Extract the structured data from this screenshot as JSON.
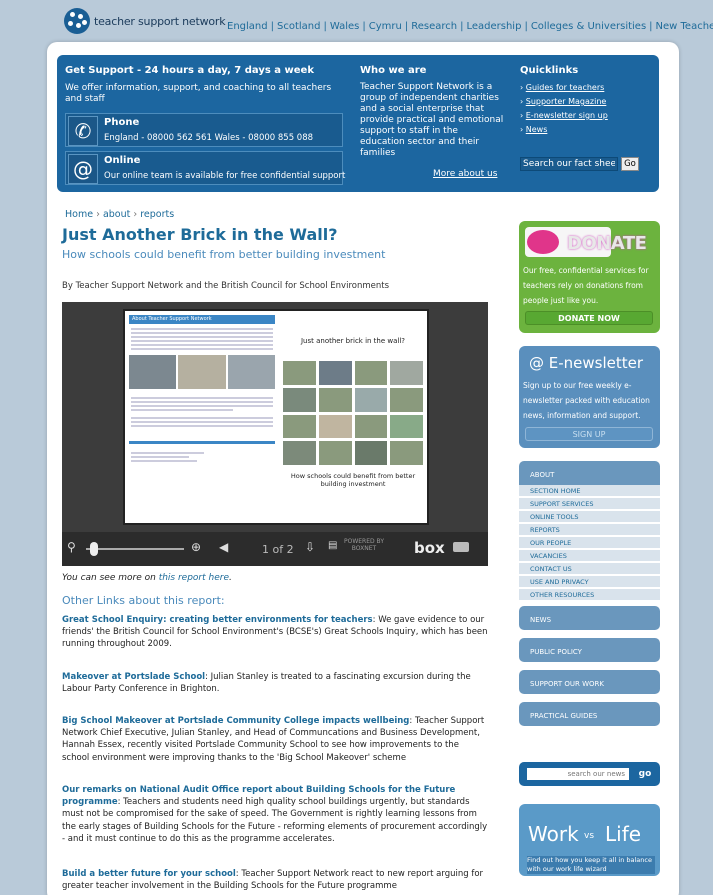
{
  "header": {
    "logo_text": "teacher support network",
    "nav": [
      "England",
      "Scotland",
      "Wales",
      "Cymru",
      "Research",
      "Leadership",
      "Colleges & Universities",
      "New Teachers"
    ]
  },
  "banner": {
    "get_support_title": "Get Support - 24 hours a day, 7 days a week",
    "get_support_text": "We offer information, support, and coaching to all teachers and staff",
    "phone_title": "Phone",
    "phone_text": "England - 08000 562 561 Wales - 08000 855 088",
    "online_title": "Online",
    "online_pre": "Our ",
    "online_link": "online team",
    "online_post": " is available for free confidential support",
    "who_title": "Who we are",
    "who_text": "Teacher Support Network is a group of independent charities and a social enterprise that provide practical and emotional support to staff in the education sector and their families",
    "who_more": "More about us",
    "quick_title": "Quicklinks",
    "quick_links": [
      "Guides for teachers",
      "Supporter Magazine",
      "E-newsletter sign up",
      "News"
    ],
    "search_placeholder": "Search our fact sheets",
    "search_go": "Go"
  },
  "breadcrumb": {
    "home": "Home",
    "about": "about",
    "current": "reports"
  },
  "article": {
    "title": "Just Another Brick in the Wall?",
    "subtitle": "How schools could benefit from better building investment",
    "byline": "By Teacher Support Network and the British Council for School Environments",
    "doc_header": "About Teacher Support Network",
    "doc_right_title": "Just another brick in the wall?",
    "doc_right_sub": "How schools could benefit from better building investment",
    "viewer_page": "1 of 2",
    "viewer_powered": "POWERED BY BOXNET",
    "viewer_brand": "box",
    "note_pre": "You can see more on ",
    "note_link": "this report here",
    "note_post": ".",
    "other_title": "Other Links about this report:",
    "links": [
      {
        "title": "Great School Enquiry: creating better environments for teachers",
        "text": ": We gave evidence to our friends' the British Council for School Environment's (BCSE's) Great Schools Inquiry, which has been running throughout 2009."
      },
      {
        "title": "Makeover at Portslade School",
        "text": ": Julian Stanley is treated to a fascinating excursion during the Labour Party Conference in Brighton."
      },
      {
        "title": "Big School Makeover at Portslade Community College impacts wellbeing",
        "text": ": Teacher Support Network Chief Executive, Julian Stanley, and Head of Communcations and Business Development, Hannah Essex, recently visited Portslade Community School to see how improvements to the school environment were improving thanks to the 'Big School Makeover' scheme"
      },
      {
        "title": "Our remarks on National Audit Office report about Building Schools for the Future programme",
        "text": ": Teachers and students need high quality school buildings urgently, but standards must not be compromised for the sake of speed. The Government is rightly learning lessons from the early stages of Building Schools for the Future - reforming elements of procurement accordingly - and it must continue to do this as the programme accelerates."
      },
      {
        "title": "Build a better future for your school",
        "text": ": Teacher Support Network react to new report arguing for greater teacher involvement in the Building Schools for the Future programme"
      }
    ]
  },
  "sidebar": {
    "donate_title": "DONATE",
    "donate_text": "Our free, confidential services for teachers rely on donations from people just like you.",
    "donate_button": "DONATE NOW",
    "enews_title": "E-newsletter",
    "enews_text": "Sign up to our free weekly e-newsletter packed with education news, information and support.",
    "enews_button": "SIGN UP",
    "about_header": "ABOUT",
    "about_items": [
      "SECTION HOME",
      "SUPPORT SERVICES",
      "ONLINE TOOLS",
      "REPORTS",
      "OUR PEOPLE",
      "VACANCIES",
      "CONTACT US",
      "USE AND PRIVACY",
      "OTHER RESOURCES"
    ],
    "menu_headers": [
      "NEWS",
      "PUBLIC POLICY",
      "SUPPORT OUR WORK",
      "PRACTICAL GUIDES"
    ],
    "news_search_placeholder": "search our news",
    "news_search_go": "go",
    "wl_work": "Work",
    "wl_vs": "vs",
    "wl_life": "Life",
    "wl_text": "Find out how you keep it all in balance with our work life wizard"
  },
  "colors": {
    "brand_blue": "#1c66a0",
    "donate_green": "#6cb33e",
    "link": "#1e6b99"
  }
}
